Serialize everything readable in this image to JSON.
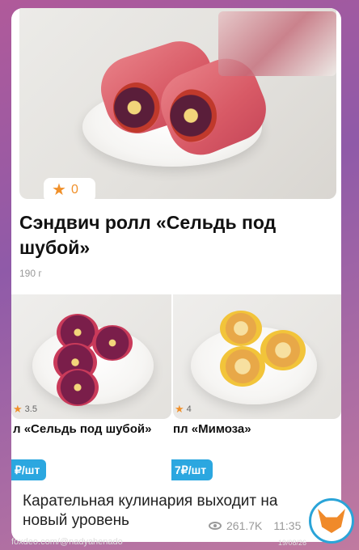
{
  "post": {
    "rating": "0",
    "title": "Сэндвич ролл «Сельдь под шубой»",
    "weight": "190 г",
    "caption": "Карательная кулинария выходит на новый уровень",
    "views": "261.7K",
    "time": "11:35"
  },
  "cards": [
    {
      "rating": "3.5",
      "name": "л «Сельдь под шубой»",
      "price": "₽/шт"
    },
    {
      "rating": "4",
      "name": "пл «Мимоза»",
      "price": "7₽/шт"
    }
  ],
  "watermark": "foxdeo.com/@nadyahenado",
  "date": "19/08/26",
  "colors": {
    "accent": "#2ba7e0",
    "star": "#f0902a"
  },
  "icons": [
    "star-icon",
    "eye-icon",
    "fox-avatar-icon"
  ]
}
